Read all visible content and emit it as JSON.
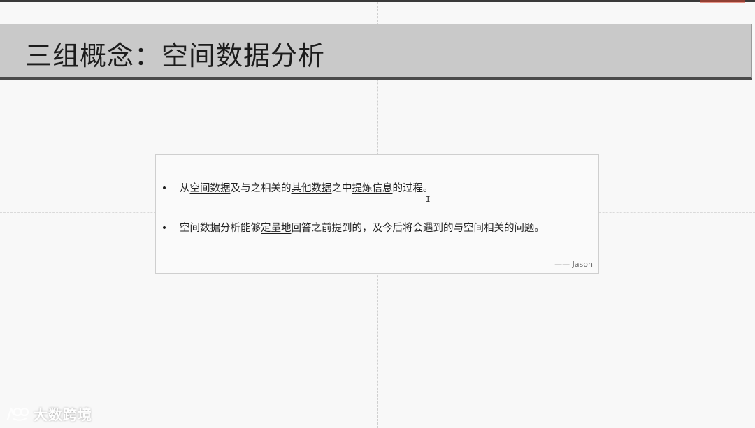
{
  "slide": {
    "title": "三组概念：空间数据分析",
    "bullets": [
      [
        {
          "t": "从",
          "u": false
        },
        {
          "t": "空间数据",
          "u": true
        },
        {
          "t": "及与之相关的",
          "u": false
        },
        {
          "t": "其他数据",
          "u": true
        },
        {
          "t": "之中",
          "u": false
        },
        {
          "t": "提炼信息",
          "u": true
        },
        {
          "t": "的过程。",
          "u": false
        }
      ],
      [
        {
          "t": "空间数据分析能够",
          "u": false
        },
        {
          "t": "定量地",
          "u": true
        },
        {
          "t": "回答之前提到的，及今后将会遇到的与空间相关的问题。",
          "u": false
        }
      ]
    ],
    "attribution": "—— Jason"
  },
  "watermark": {
    "text": "大数跨境"
  },
  "colors": {
    "title_bar": "#c9c9c9",
    "title_text": "#1c1c1c",
    "accent_red": "#d9442e"
  }
}
